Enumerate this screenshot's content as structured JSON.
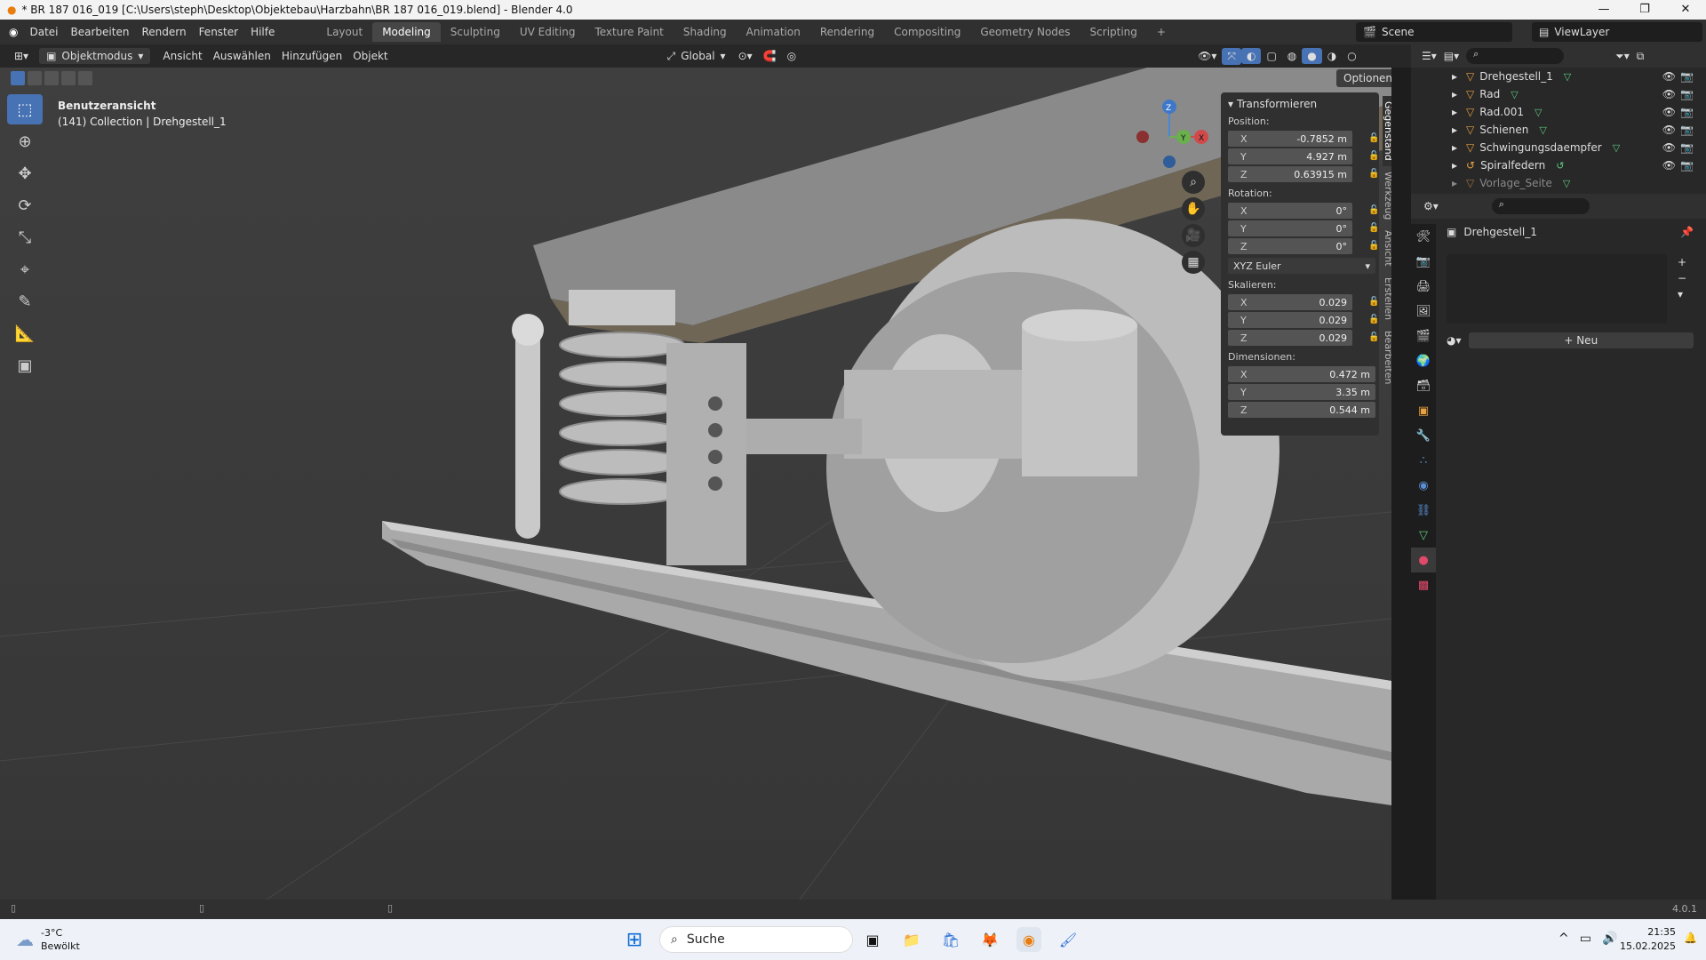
{
  "window": {
    "title": "* BR 187 016_019 [C:\\Users\\steph\\Desktop\\Objektebau\\Harzbahn\\BR 187 016_019.blend] - Blender 4.0",
    "controls": [
      "—",
      "❐",
      "✕"
    ]
  },
  "menu": [
    "Datei",
    "Bearbeiten",
    "Rendern",
    "Fenster",
    "Hilfe"
  ],
  "workspaces": [
    "Layout",
    "Modeling",
    "Sculpting",
    "UV Editing",
    "Texture Paint",
    "Shading",
    "Animation",
    "Rendering",
    "Compositing",
    "Geometry Nodes",
    "Scripting",
    "+"
  ],
  "active_workspace": "Modeling",
  "scene": "Scene",
  "view_layer": "ViewLayer",
  "header": {
    "mode": "Objektmodus",
    "menus": [
      "Ansicht",
      "Auswählen",
      "Hinzufügen",
      "Objekt"
    ],
    "orientation": "Global",
    "options": "Optionen"
  },
  "viewport": {
    "view_name": "Benutzeransicht",
    "collection_info": "(141) Collection | Drehgestell_1"
  },
  "npanel": {
    "title": "Transformieren",
    "position_label": "Position:",
    "position": {
      "x": "-0.7852 m",
      "y": "4.927 m",
      "z": "0.63915 m"
    },
    "rotation_label": "Rotation:",
    "rotation": {
      "x": "0°",
      "y": "0°",
      "z": "0°"
    },
    "rotation_mode": "XYZ Euler",
    "scale_label": "Skalieren:",
    "scale": {
      "x": "0.029",
      "y": "0.029",
      "z": "0.029"
    },
    "dimensions_label": "Dimensionen:",
    "dimensions": {
      "x": "0.472 m",
      "y": "3.35 m",
      "z": "0.544 m"
    },
    "axis": {
      "x": "X",
      "y": "Y",
      "z": "Z"
    }
  },
  "side_tabs": [
    "Gegenstand",
    "Werkzeug",
    "Ansicht",
    "Erstellen",
    "Bearbeiten"
  ],
  "outliner": {
    "items": [
      {
        "name": "Drehgestell_1"
      },
      {
        "name": "Rad"
      },
      {
        "name": "Rad.001"
      },
      {
        "name": "Schienen"
      },
      {
        "name": "Schwingungsdaempfer"
      },
      {
        "name": "Spiralfedern"
      },
      {
        "name": "Vorlage_Seite"
      }
    ]
  },
  "properties": {
    "object_name": "Drehgestell_1",
    "new_button": "Neu"
  },
  "status": {
    "version": "4.0.1"
  },
  "taskbar": {
    "weather_temp": "-3°C",
    "weather_desc": "Bewölkt",
    "search_placeholder": "Suche",
    "time": "21:35",
    "date": "15.02.2025"
  }
}
